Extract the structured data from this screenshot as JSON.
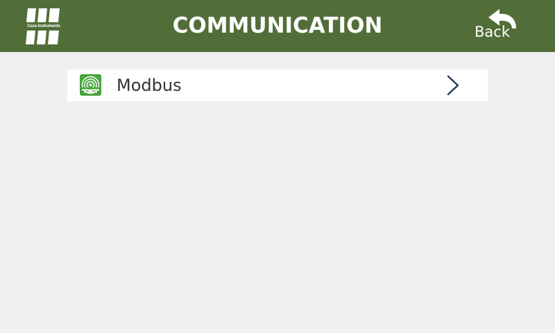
{
  "header": {
    "title": "COMMUNICATION",
    "logo_text": "Cass Instruments",
    "back_label": "Back",
    "background_color": "#526e38"
  },
  "menu": {
    "items": [
      {
        "label": "Modbus",
        "icon": "modbus-signal-icon",
        "icon_color": "#48a43c",
        "chevron": "chevron-right-icon"
      }
    ]
  },
  "colors": {
    "page_background": "#f0f0f0",
    "chevron": "#233a53"
  }
}
